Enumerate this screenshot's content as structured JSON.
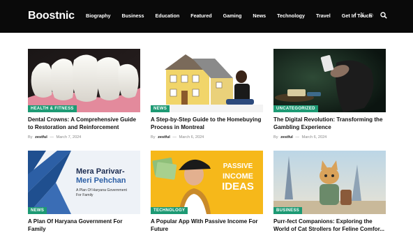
{
  "header": {
    "logo": "Boostnic",
    "nav": [
      "Biography",
      "Business",
      "Education",
      "Featured",
      "Gaming",
      "News",
      "Technology",
      "Travel",
      "Get In Touch"
    ],
    "social": [
      "f",
      "𝕏",
      "◎"
    ]
  },
  "posts": [
    {
      "category": "HEALTH & FITNESS",
      "title": "Dental Crowns: A Comprehensive Guide to Restoration and Reinforcement",
      "author": "zestful",
      "date": "March 7, 2024"
    },
    {
      "category": "NEWS",
      "title": "A Step-by-Step Guide to the Homebuying Process in Montreal",
      "author": "zestful",
      "date": "March 6, 2024"
    },
    {
      "category": "UNCATEGORIZED",
      "title": "The Digital Revolution: Transforming the Gambling Experience",
      "author": "zestful",
      "date": "March 6, 2024"
    },
    {
      "category": "NEWS",
      "title": "A Plan Of Haryana Government For Family",
      "thumb_text": {
        "line1": "Mera Parivar-",
        "line2": "Meri Pehchan",
        "sub": "A Plan Of Haryana Government For Family"
      }
    },
    {
      "category": "TECHNOLOGY",
      "title": "A Popular App With Passive Income For Future",
      "thumb_text": {
        "line1": "PASSIVE",
        "line2": "INCOME",
        "line3": "IDEAS"
      }
    },
    {
      "category": "BUSINESS",
      "title": "Purr-fect Companions: Exploring the World of Cat Strollers for Feline Comfor..."
    }
  ],
  "meta_by": "By",
  "meta_sep": "—",
  "colors": {
    "badge": "#1d9a74",
    "header_bg": "#0a0a0a"
  }
}
